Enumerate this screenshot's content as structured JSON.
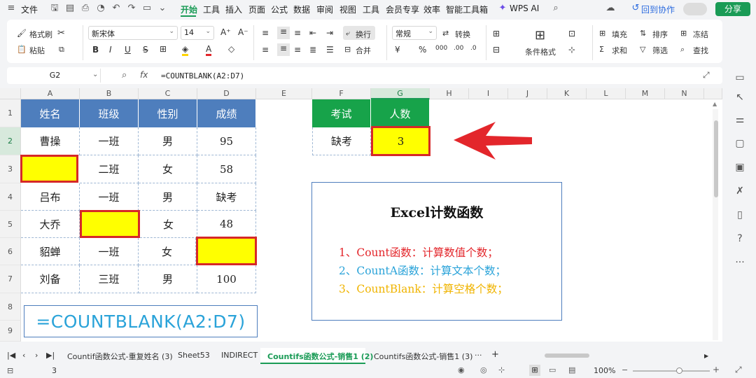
{
  "menubar": {
    "file": "文件",
    "tabs": [
      "开始",
      "工具",
      "插入",
      "页面",
      "公式",
      "数据",
      "审阅",
      "视图",
      "工具",
      "会员专享",
      "效率",
      "智能工具箱"
    ],
    "wps_ai": "WPS AI",
    "collab": "回到协作",
    "share": "分享"
  },
  "ribbon": {
    "format_painter": "格式刷",
    "paste": "粘贴",
    "font_name": "新宋体",
    "font_size": "14",
    "wrap": "换行",
    "merge": "合并",
    "number_format": "常规",
    "convert": "转换",
    "cond_format": "条件格式",
    "fill": "填充",
    "sum": "求和",
    "sort": "排序",
    "filter": "筛选",
    "freeze": "冻结",
    "find": "查找"
  },
  "formula_bar": {
    "cell_ref": "G2",
    "formula": "=COUNTBLANK(A2:D7)"
  },
  "grid": {
    "columns": [
      "A",
      "B",
      "C",
      "D",
      "E",
      "F",
      "G",
      "H",
      "I",
      "J",
      "K",
      "L",
      "M",
      "N"
    ],
    "rows": [
      "1",
      "2",
      "3",
      "4",
      "5",
      "6",
      "7",
      "8",
      "9"
    ],
    "table_header": [
      "姓名",
      "班级",
      "性别",
      "成绩"
    ],
    "table_rows": [
      [
        "曹操",
        "一班",
        "男",
        "95"
      ],
      [
        "",
        "二班",
        "女",
        "58"
      ],
      [
        "吕布",
        "一班",
        "男",
        "缺考"
      ],
      [
        "大乔",
        "",
        "女",
        "48"
      ],
      [
        "貂蝉",
        "一班",
        "女",
        ""
      ],
      [
        "刘备",
        "三班",
        "男",
        "100"
      ]
    ],
    "formula_display": "=COUNTBLANK(A2:D7)",
    "result_header": [
      "考试",
      "人数"
    ],
    "result_row": [
      "缺考",
      "3"
    ]
  },
  "note_box": {
    "title": "Excel计数函数",
    "line1": "1、Count函数：计算数值个数；",
    "line2": "2、CountA函数：计算文本个数；",
    "line3": "3、CountBlank：计算空格个数；",
    "colors": {
      "line1": "#e3262b",
      "line2": "#2aa3d9",
      "line3": "#f0b400"
    }
  },
  "sheet_tabs": [
    "Countif函数公式-重复姓名 (3)",
    "Sheet53",
    "INDIRECT",
    "Countifs函数公式-销售1 (2)",
    "Countifs函数公式-销售1 (3)"
  ],
  "status": {
    "count_value": "3",
    "zoom": "100%"
  },
  "colors": {
    "accent": "#1a9b56",
    "header_blue": "#4e7ebd",
    "header_green": "#17a34a",
    "highlight_yellow": "#ffff00",
    "highlight_border": "#d62828",
    "arrow_red": "#e3262b"
  }
}
